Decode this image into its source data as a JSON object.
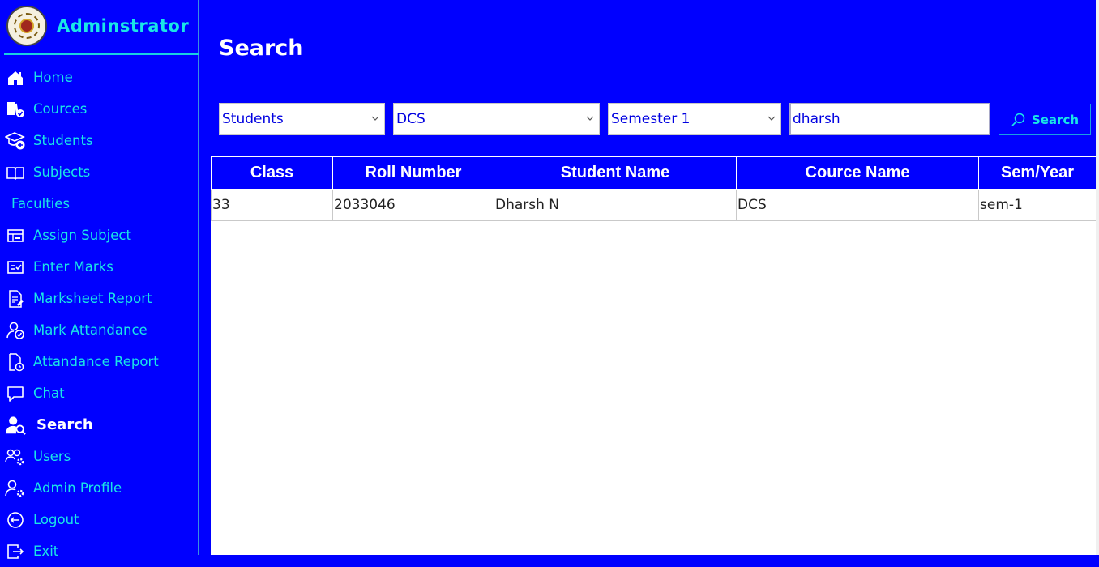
{
  "sidebar": {
    "brand_title": "Adminstrator",
    "items": [
      {
        "label": "Home",
        "icon": "home-icon"
      },
      {
        "label": "Cources",
        "icon": "courses-icon"
      },
      {
        "label": "Students",
        "icon": "student-add-icon"
      },
      {
        "label": "Subjects",
        "icon": "book-icon"
      },
      {
        "label": "Faculties",
        "icon": ""
      },
      {
        "label": "Assign Subject",
        "icon": "assign-icon"
      },
      {
        "label": "Enter Marks",
        "icon": "marks-icon"
      },
      {
        "label": "Marksheet Report",
        "icon": "report-icon"
      },
      {
        "label": "Mark Attandance",
        "icon": "user-check-icon"
      },
      {
        "label": "Attandance Report",
        "icon": "document-clock-icon"
      },
      {
        "label": "Chat",
        "icon": "chat-icon"
      },
      {
        "label": "Search",
        "icon": "user-search-icon",
        "active": true
      },
      {
        "label": "Users",
        "icon": "users-gear-icon"
      },
      {
        "label": "Admin Profile",
        "icon": "user-gear-icon"
      },
      {
        "label": "Logout",
        "icon": "logout-icon"
      },
      {
        "label": "Exit",
        "icon": "exit-icon"
      }
    ]
  },
  "main": {
    "title": "Search",
    "filters": {
      "type_selected": "Students",
      "course_selected": "DCS",
      "semester_selected": "Semester 1",
      "query_value": "dharsh",
      "search_label": "Search"
    },
    "table": {
      "headers": [
        "Class",
        "Roll Number",
        "Student Name",
        "Cource Name",
        "Sem/Year"
      ],
      "rows": [
        [
          "33",
          "2033046",
          "Dharsh N",
          "DCS",
          "sem-1"
        ]
      ]
    }
  },
  "colors": {
    "background": "#0000ff",
    "accent_text": "#19e6e6",
    "active_text": "#ffffff",
    "table_bg": "#ffffff"
  }
}
